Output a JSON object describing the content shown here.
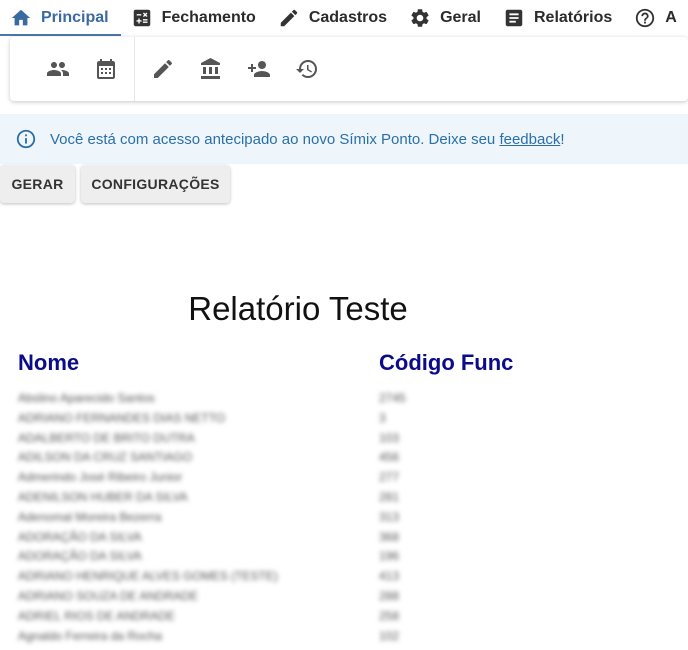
{
  "nav": {
    "tabs": [
      {
        "label": "Principal",
        "icon": "home-icon",
        "active": true
      },
      {
        "label": "Fechamento",
        "icon": "calculator-icon",
        "active": false
      },
      {
        "label": "Cadastros",
        "icon": "pencil-icon",
        "active": false
      },
      {
        "label": "Geral",
        "icon": "gear-icon",
        "active": false
      },
      {
        "label": "Relatórios",
        "icon": "document-icon",
        "active": false
      },
      {
        "label": "A",
        "icon": "help-icon",
        "active": false
      }
    ]
  },
  "toolbar": {
    "icons": [
      "people-icon",
      "calendar-icon",
      "pencil-icon",
      "bank-icon",
      "person-add-icon",
      "history-icon"
    ]
  },
  "banner": {
    "text": "Você está com acesso antecipado ao novo Símix Ponto. Deixe seu ",
    "link": "feedback",
    "suffix": "!"
  },
  "actions": {
    "gerar": "GERAR",
    "config": "CONFIGURAÇÕES"
  },
  "report": {
    "title": "Relatório Teste",
    "col_name": "Nome",
    "col_code": "Código Func",
    "rows": [
      {
        "name": "Abslino Aparecido Santos",
        "code": "2745"
      },
      {
        "name": "ADRIANO FERNANDES DIAS NETTO",
        "code": "3"
      },
      {
        "name": "ADALBERTO DE BRITO DUTRA",
        "code": "103"
      },
      {
        "name": "ADILSON DA CRUZ SANTIAGO",
        "code": "456"
      },
      {
        "name": "Admerindo José Ribeiro Junior",
        "code": "277"
      },
      {
        "name": "ADENILSON HUBER DA SILVA",
        "code": "281"
      },
      {
        "name": "Adenomal Moreira Bezerra",
        "code": "313"
      },
      {
        "name": "ADORAÇÃO DA SILVA",
        "code": "368"
      },
      {
        "name": "ADORAÇÃO DA SILVA",
        "code": "196"
      },
      {
        "name": "ADRIANO HENRIQUE ALVES GOMES (TESTE)",
        "code": "413"
      },
      {
        "name": "ADRIANO SOUZA DE ANDRADE",
        "code": "288"
      },
      {
        "name": "ADRIEL RIOS DE ANDRADE",
        "code": "258"
      },
      {
        "name": "Agnaldo Ferreira da Rocha",
        "code": "102"
      }
    ]
  }
}
